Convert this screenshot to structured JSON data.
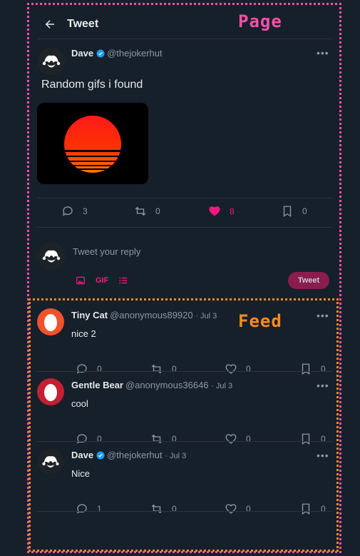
{
  "annotations": {
    "page_label": "Page",
    "feed_label": "Feed"
  },
  "header": {
    "title": "Tweet"
  },
  "post": {
    "author_name": "Dave",
    "author_handle": "@thejokerhut",
    "text": "Random gifs i found",
    "stats": {
      "replies": "3",
      "retweets": "0",
      "likes": "8",
      "bookmarks": "0"
    }
  },
  "reply_box": {
    "placeholder": "Tweet your reply",
    "gif_label": "GIF",
    "button_label": "Tweet"
  },
  "feed": [
    {
      "name": "Tiny Cat",
      "handle": "@anonymous89920",
      "time": "· Jul 3",
      "text": "nice 2",
      "replies": "0",
      "retweets": "0",
      "likes": "0",
      "bookmarks": "0"
    },
    {
      "name": "Gentle Bear",
      "handle": "@anonymous36646",
      "time": "· Jul 3",
      "text": "cool",
      "replies": "0",
      "retweets": "0",
      "likes": "0",
      "bookmarks": "0"
    },
    {
      "name": "Dave",
      "handle": "@thejokerhut",
      "time": "· Jul 3",
      "text": "Nice",
      "replies": "1",
      "retweets": "0",
      "likes": "0",
      "bookmarks": "0"
    }
  ],
  "colors": {
    "background": "#15202b",
    "like_active": "#f91880",
    "verified": "#1d9bf0",
    "page_outline": "#ff4fa8",
    "feed_outline": "#ff8a1f"
  }
}
